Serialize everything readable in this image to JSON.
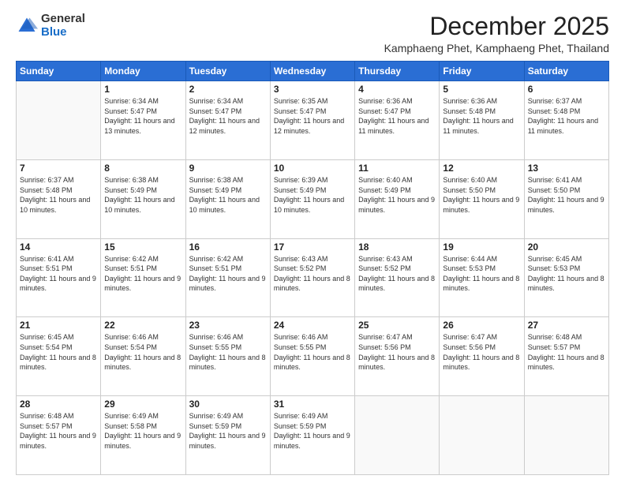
{
  "logo": {
    "general": "General",
    "blue": "Blue"
  },
  "header": {
    "month_year": "December 2025",
    "location": "Kamphaeng Phet, Kamphaeng Phet, Thailand"
  },
  "days_of_week": [
    "Sunday",
    "Monday",
    "Tuesday",
    "Wednesday",
    "Thursday",
    "Friday",
    "Saturday"
  ],
  "weeks": [
    [
      {
        "day": "",
        "sunrise": "",
        "sunset": "",
        "daylight": ""
      },
      {
        "day": "1",
        "sunrise": "Sunrise: 6:34 AM",
        "sunset": "Sunset: 5:47 PM",
        "daylight": "Daylight: 11 hours and 13 minutes."
      },
      {
        "day": "2",
        "sunrise": "Sunrise: 6:34 AM",
        "sunset": "Sunset: 5:47 PM",
        "daylight": "Daylight: 11 hours and 12 minutes."
      },
      {
        "day": "3",
        "sunrise": "Sunrise: 6:35 AM",
        "sunset": "Sunset: 5:47 PM",
        "daylight": "Daylight: 11 hours and 12 minutes."
      },
      {
        "day": "4",
        "sunrise": "Sunrise: 6:36 AM",
        "sunset": "Sunset: 5:47 PM",
        "daylight": "Daylight: 11 hours and 11 minutes."
      },
      {
        "day": "5",
        "sunrise": "Sunrise: 6:36 AM",
        "sunset": "Sunset: 5:48 PM",
        "daylight": "Daylight: 11 hours and 11 minutes."
      },
      {
        "day": "6",
        "sunrise": "Sunrise: 6:37 AM",
        "sunset": "Sunset: 5:48 PM",
        "daylight": "Daylight: 11 hours and 11 minutes."
      }
    ],
    [
      {
        "day": "7",
        "sunrise": "Sunrise: 6:37 AM",
        "sunset": "Sunset: 5:48 PM",
        "daylight": "Daylight: 11 hours and 10 minutes."
      },
      {
        "day": "8",
        "sunrise": "Sunrise: 6:38 AM",
        "sunset": "Sunset: 5:49 PM",
        "daylight": "Daylight: 11 hours and 10 minutes."
      },
      {
        "day": "9",
        "sunrise": "Sunrise: 6:38 AM",
        "sunset": "Sunset: 5:49 PM",
        "daylight": "Daylight: 11 hours and 10 minutes."
      },
      {
        "day": "10",
        "sunrise": "Sunrise: 6:39 AM",
        "sunset": "Sunset: 5:49 PM",
        "daylight": "Daylight: 11 hours and 10 minutes."
      },
      {
        "day": "11",
        "sunrise": "Sunrise: 6:40 AM",
        "sunset": "Sunset: 5:49 PM",
        "daylight": "Daylight: 11 hours and 9 minutes."
      },
      {
        "day": "12",
        "sunrise": "Sunrise: 6:40 AM",
        "sunset": "Sunset: 5:50 PM",
        "daylight": "Daylight: 11 hours and 9 minutes."
      },
      {
        "day": "13",
        "sunrise": "Sunrise: 6:41 AM",
        "sunset": "Sunset: 5:50 PM",
        "daylight": "Daylight: 11 hours and 9 minutes."
      }
    ],
    [
      {
        "day": "14",
        "sunrise": "Sunrise: 6:41 AM",
        "sunset": "Sunset: 5:51 PM",
        "daylight": "Daylight: 11 hours and 9 minutes."
      },
      {
        "day": "15",
        "sunrise": "Sunrise: 6:42 AM",
        "sunset": "Sunset: 5:51 PM",
        "daylight": "Daylight: 11 hours and 9 minutes."
      },
      {
        "day": "16",
        "sunrise": "Sunrise: 6:42 AM",
        "sunset": "Sunset: 5:51 PM",
        "daylight": "Daylight: 11 hours and 9 minutes."
      },
      {
        "day": "17",
        "sunrise": "Sunrise: 6:43 AM",
        "sunset": "Sunset: 5:52 PM",
        "daylight": "Daylight: 11 hours and 8 minutes."
      },
      {
        "day": "18",
        "sunrise": "Sunrise: 6:43 AM",
        "sunset": "Sunset: 5:52 PM",
        "daylight": "Daylight: 11 hours and 8 minutes."
      },
      {
        "day": "19",
        "sunrise": "Sunrise: 6:44 AM",
        "sunset": "Sunset: 5:53 PM",
        "daylight": "Daylight: 11 hours and 8 minutes."
      },
      {
        "day": "20",
        "sunrise": "Sunrise: 6:45 AM",
        "sunset": "Sunset: 5:53 PM",
        "daylight": "Daylight: 11 hours and 8 minutes."
      }
    ],
    [
      {
        "day": "21",
        "sunrise": "Sunrise: 6:45 AM",
        "sunset": "Sunset: 5:54 PM",
        "daylight": "Daylight: 11 hours and 8 minutes."
      },
      {
        "day": "22",
        "sunrise": "Sunrise: 6:46 AM",
        "sunset": "Sunset: 5:54 PM",
        "daylight": "Daylight: 11 hours and 8 minutes."
      },
      {
        "day": "23",
        "sunrise": "Sunrise: 6:46 AM",
        "sunset": "Sunset: 5:55 PM",
        "daylight": "Daylight: 11 hours and 8 minutes."
      },
      {
        "day": "24",
        "sunrise": "Sunrise: 6:46 AM",
        "sunset": "Sunset: 5:55 PM",
        "daylight": "Daylight: 11 hours and 8 minutes."
      },
      {
        "day": "25",
        "sunrise": "Sunrise: 6:47 AM",
        "sunset": "Sunset: 5:56 PM",
        "daylight": "Daylight: 11 hours and 8 minutes."
      },
      {
        "day": "26",
        "sunrise": "Sunrise: 6:47 AM",
        "sunset": "Sunset: 5:56 PM",
        "daylight": "Daylight: 11 hours and 8 minutes."
      },
      {
        "day": "27",
        "sunrise": "Sunrise: 6:48 AM",
        "sunset": "Sunset: 5:57 PM",
        "daylight": "Daylight: 11 hours and 8 minutes."
      }
    ],
    [
      {
        "day": "28",
        "sunrise": "Sunrise: 6:48 AM",
        "sunset": "Sunset: 5:57 PM",
        "daylight": "Daylight: 11 hours and 9 minutes."
      },
      {
        "day": "29",
        "sunrise": "Sunrise: 6:49 AM",
        "sunset": "Sunset: 5:58 PM",
        "daylight": "Daylight: 11 hours and 9 minutes."
      },
      {
        "day": "30",
        "sunrise": "Sunrise: 6:49 AM",
        "sunset": "Sunset: 5:59 PM",
        "daylight": "Daylight: 11 hours and 9 minutes."
      },
      {
        "day": "31",
        "sunrise": "Sunrise: 6:49 AM",
        "sunset": "Sunset: 5:59 PM",
        "daylight": "Daylight: 11 hours and 9 minutes."
      },
      {
        "day": "",
        "sunrise": "",
        "sunset": "",
        "daylight": ""
      },
      {
        "day": "",
        "sunrise": "",
        "sunset": "",
        "daylight": ""
      },
      {
        "day": "",
        "sunrise": "",
        "sunset": "",
        "daylight": ""
      }
    ]
  ]
}
